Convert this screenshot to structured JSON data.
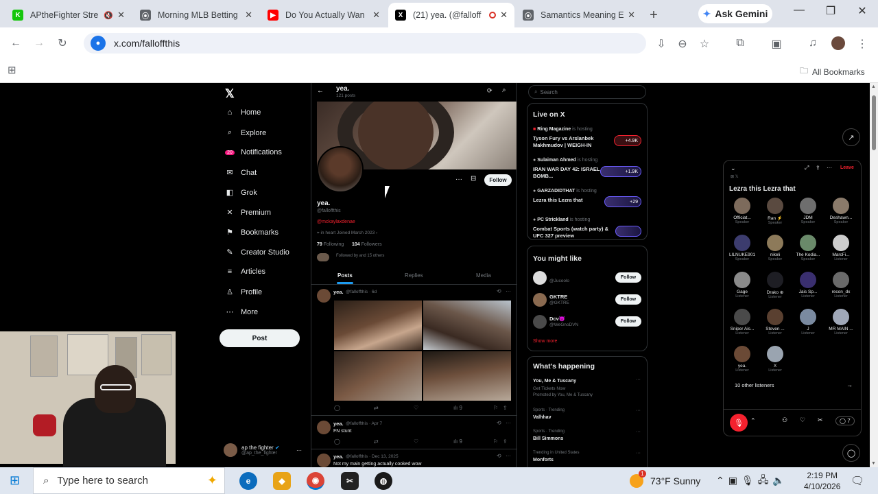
{
  "browser": {
    "tabs": [
      {
        "title": "APtheFighter Stre",
        "fav_color": "#16c60c",
        "fav_text": "K",
        "muted": true
      },
      {
        "title": "Morning MLB Betting",
        "fav_color": "#5f6368",
        "fav_text": "⦿"
      },
      {
        "title": "Do You Actually Wan",
        "fav_color": "#ff0000",
        "fav_text": "▶"
      },
      {
        "title": "(21) yea. (@falloff",
        "fav_color": "#000000",
        "fav_text": "X",
        "active": true
      },
      {
        "title": "Samantics Meaning E",
        "fav_color": "#5f6368",
        "fav_text": "⦿"
      }
    ],
    "gemini_label": "Ask Gemini",
    "url": "x.com/falloffthis",
    "all_bookmarks": "All Bookmarks"
  },
  "x_nav": {
    "items": [
      {
        "label": "Home",
        "icon": "⌂"
      },
      {
        "label": "Explore",
        "icon": "⌕"
      },
      {
        "label": "Notifications",
        "icon": "🔔"
      },
      {
        "label": "Chat",
        "icon": "✉"
      },
      {
        "label": "Grok",
        "icon": "◧"
      },
      {
        "label": "Premium",
        "icon": "✕"
      },
      {
        "label": "Bookmarks",
        "icon": "⚑"
      },
      {
        "label": "Creator Studio",
        "icon": "✎"
      },
      {
        "label": "Articles",
        "icon": "≡"
      },
      {
        "label": "Profile",
        "icon": "♙"
      },
      {
        "label": "More",
        "icon": "⋯"
      }
    ],
    "post_label": "Post",
    "account_name": "ap the fighter",
    "account_handle": "@ap_the_fighter"
  },
  "profile": {
    "header_name": "yea.",
    "header_posts": "121 posts",
    "name": "yea.",
    "handle": "@falloffthis",
    "link": "@mckaylaxdenae",
    "meta": "in heart   Joined March 2023",
    "following_count": "79",
    "following_label": "Following",
    "followers_count": "104",
    "followers_label": "Followers",
    "followed_by": "Followed by and 15 others",
    "follow_label": "Follow",
    "tabs": [
      "Posts",
      "Replies",
      "Media"
    ]
  },
  "posts": [
    {
      "name": "yea.",
      "meta": "@falloffthis · 6d",
      "text": "",
      "views": "9"
    },
    {
      "name": "yea.",
      "meta": "@falloffthis · Apr 7",
      "text": "FN stunt",
      "views": "9"
    },
    {
      "name": "yea.",
      "meta": "@falloffthis · Dec 13, 2025",
      "text": "Not my main getting actually cooked wow"
    }
  ],
  "sidebar": {
    "search_placeholder": "Search",
    "live_title": "Live on X",
    "live": [
      {
        "host": "Ring Magazine",
        "tag": "is hosting",
        "title": "Tyson Fury vs Arslanbek Makhmudov | WEIGH-IN",
        "count": "+4.9K"
      },
      {
        "host": "Sulaiman Ahmed",
        "tag": "is hosting",
        "title": "IRAN WAR DAY 42: ISRAEL BOMB...",
        "count": "+1.9K"
      },
      {
        "host": "GARZADIDTHAT",
        "tag": "is hosting",
        "title": "Lezra this Lezra that",
        "count": "+29"
      },
      {
        "host": "PC Strickland",
        "tag": "is hosting",
        "title": "Combat Sports (watch party) & UFC 327 preview",
        "count": ""
      }
    ],
    "might_like_title": "You might like",
    "might_like": [
      {
        "name": "",
        "handle": "@Jucoolo",
        "btn": "Follow"
      },
      {
        "name": "GKTRE",
        "handle": "@GKTRE",
        "btn": "Follow"
      },
      {
        "name": "Dcv😈",
        "handle": "@WeGnoDVN",
        "btn": "Follow"
      }
    ],
    "show_more": "Show more",
    "happening_title": "What's happening",
    "happening": [
      {
        "context": "",
        "title": "You, Me & Tuscany",
        "sub": "Get Tickets Now",
        "promo": "Promoted by You, Me & Tuscany"
      },
      {
        "context": "Sports · Trending",
        "title": "Valhhav"
      },
      {
        "context": "Sports · Trending",
        "title": "Bill Simmons"
      },
      {
        "context": "Trending in United States",
        "title": "Monforts"
      }
    ]
  },
  "space": {
    "title": "Lezra this Lezra that",
    "leave_label": "Leave",
    "speakers": [
      {
        "name": "Officiat...",
        "role": "Speaker",
        "color": "#7d6b5c"
      },
      {
        "name": "Ran ⚡",
        "role": "Speaker",
        "color": "#5a4a40"
      },
      {
        "name": "JDM",
        "role": "Speaker",
        "color": "#6e6e6e"
      },
      {
        "name": "Deshawn...",
        "role": "Speaker",
        "color": "#8a7a6a"
      },
      {
        "name": "LILNUKE901",
        "role": "Speaker",
        "color": "#3c3c6e"
      },
      {
        "name": "nikeli",
        "role": "Speaker",
        "color": "#8d7a5a"
      },
      {
        "name": "The Kodia...",
        "role": "Speaker",
        "color": "#6a8a6a"
      },
      {
        "name": "MarcFi...",
        "role": "Listener",
        "color": "#cccccc"
      },
      {
        "name": "Gage",
        "role": "Listener",
        "color": "#8a8a8a"
      },
      {
        "name": "Drako ⊕",
        "role": "Listener",
        "color": "#1e1e24"
      },
      {
        "name": "Jais Sp...",
        "role": "Listener",
        "color": "#3a2f6f"
      },
      {
        "name": "recon_dx",
        "role": "Listener",
        "color": "#6a6a6a"
      },
      {
        "name": "Sniper Ais...",
        "role": "Listener",
        "color": "#4a4a4a"
      },
      {
        "name": "Steven ...",
        "role": "Listener",
        "color": "#5a4030"
      },
      {
        "name": "J",
        "role": "Listener",
        "color": "#7a8aa0"
      },
      {
        "name": "MR MAIN ...",
        "role": "Listener",
        "color": "#a0a8b8"
      },
      {
        "name": "yea.",
        "role": "Listener",
        "color": "#6b4a36"
      },
      {
        "name": "X",
        "role": "Listener",
        "color": "#9aa4b0"
      }
    ],
    "other_listeners": "10 other listeners",
    "comments": "7"
  },
  "taskbar": {
    "search_placeholder": "Type here to search",
    "weather": "73°F  Sunny",
    "time": "2:19 PM",
    "date": "4/10/2026",
    "notif_count": "1"
  }
}
